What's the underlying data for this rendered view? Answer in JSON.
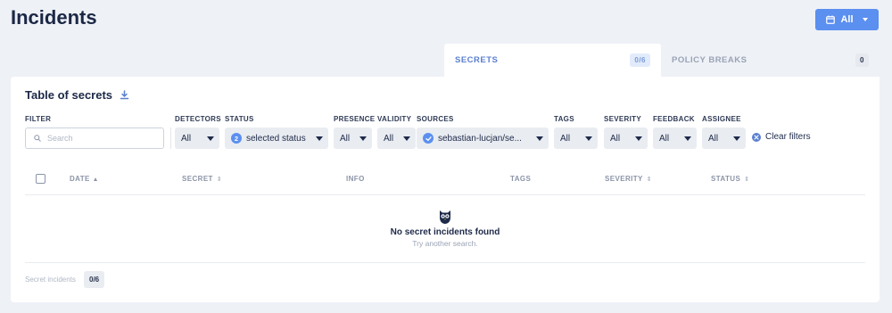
{
  "header": {
    "title": "Incidents",
    "date_filter_label": "All"
  },
  "tabs": [
    {
      "label": "SECRETS",
      "count": "0/6"
    },
    {
      "label": "POLICY BREAKS",
      "count": "0"
    }
  ],
  "table": {
    "title": "Table of secrets",
    "filters": {
      "filter_label": "FILTER",
      "search_placeholder": "Search",
      "detectors": {
        "label": "DETECTORS",
        "value": "All"
      },
      "status": {
        "label": "STATUS",
        "badge": "2",
        "value": "selected status"
      },
      "presence": {
        "label": "PRESENCE",
        "value": "All"
      },
      "validity": {
        "label": "VALIDITY",
        "value": "All"
      },
      "sources": {
        "label": "SOURCES",
        "value": "sebastian-lucjan/se..."
      },
      "tags": {
        "label": "TAGS",
        "value": "All"
      },
      "severity": {
        "label": "SEVERITY",
        "value": "All"
      },
      "feedback": {
        "label": "FEEDBACK",
        "value": "All"
      },
      "assignee": {
        "label": "ASSIGNEE",
        "value": "All"
      },
      "clear_label": "Clear filters"
    },
    "columns": {
      "date": "DATE",
      "secret": "SECRET",
      "info": "INFO",
      "tags": "TAGS",
      "severity": "SEVERITY",
      "status": "STATUS"
    },
    "empty": {
      "title": "No secret incidents found",
      "subtitle": "Try another search."
    },
    "footer": {
      "label": "Secret incidents",
      "count": "0/6"
    }
  },
  "colors": {
    "accent": "#5b8ff0",
    "background": "#eef1f6",
    "text": "#1e2a4a"
  }
}
